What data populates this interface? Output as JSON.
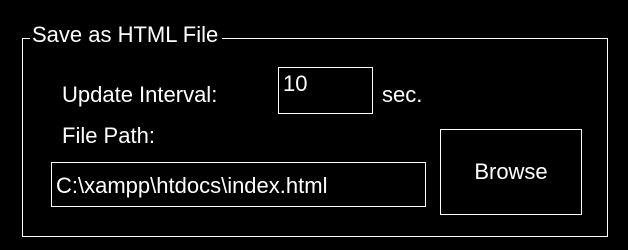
{
  "group": {
    "title": "Save as HTML File"
  },
  "update_interval": {
    "label": "Update Interval:",
    "value": "10",
    "unit": "sec."
  },
  "file_path": {
    "label": "File Path:",
    "value": "C:\\xampp\\htdocs\\index.html"
  },
  "browse_button": {
    "label": "Browse"
  },
  "colors": {
    "background": "#000000",
    "foreground": "#ffffff",
    "border": "#ffffff"
  }
}
